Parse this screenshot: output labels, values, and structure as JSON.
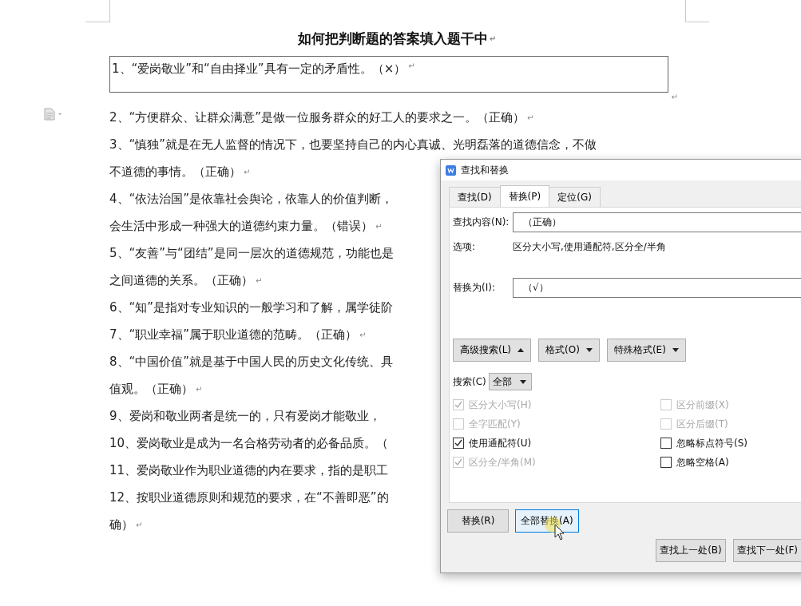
{
  "document": {
    "title": "如何把判断题的答案填入题干中",
    "title_end": "↵",
    "text_box": {
      "text": "1、“爱岗敬业”和“自由择业”具有一定的矛盾性。（×）",
      "end": "↵",
      "after": "↵"
    },
    "lines": [
      {
        "text": "2、“方便群众、让群众满意”是做一位服务群众的好工人的要求之一。（正确）",
        "end": "↵"
      },
      {
        "text": "3、“慎独”就是在无人监督的情况下，也要坚持自己的内心真诚、光明磊落的道德信念，不做"
      },
      {
        "text": "不道德的事情。（正确）",
        "end": "↵"
      },
      {
        "text": "4、“依法治国”是依靠社会舆论，依靠人的价值判断，"
      },
      {
        "text": "会生活中形成一种强大的道德约束力量。（错误）",
        "end": "↵"
      },
      {
        "text": "5、“友善”与“团结”是同一层次的道德规范，功能也是"
      },
      {
        "text": "之间道德的关系。（正确）",
        "end": "↵"
      },
      {
        "text": "6、“知”是指对专业知识的一般学习和了解，属学徒阶"
      },
      {
        "text": "7、“职业幸福”属于职业道德的范畴。（正确）",
        "end": "↵"
      },
      {
        "text": "8、“中国价值”就是基于中国人民的历史文化传统、具"
      },
      {
        "text": "值观。（正确）",
        "end": "↵"
      },
      {
        "text": "9、爱岗和敬业两者是统一的，只有爱岗才能敬业，"
      },
      {
        "text": "10、爱岗敬业是成为一名合格劳动者的必备品质。（"
      },
      {
        "text": "11、爱岗敬业作为职业道德的内在要求，指的是职工"
      },
      {
        "text": "12、按职业道德原则和规范的要求，在“不善即恶”的"
      },
      {
        "text": "确）",
        "end": "↵"
      }
    ]
  },
  "dialog": {
    "title": "查找和替换",
    "tabs": [
      {
        "label": "查找(D)",
        "selected": false
      },
      {
        "label": "替换(P)",
        "selected": true
      },
      {
        "label": "定位(G)",
        "selected": false
      }
    ],
    "find": {
      "label": "查找内容(N):",
      "value": "（正确）"
    },
    "options": {
      "label": "选项:",
      "value": "区分大小写,使用通配符,区分全/半角"
    },
    "replace": {
      "label": "替换为(I):",
      "value": "（√）"
    },
    "tool_buttons": [
      {
        "label": "高级搜索(L)",
        "kind": "collapse"
      },
      {
        "label": "格式(O)",
        "kind": "dropdown"
      },
      {
        "label": "特殊格式(E)",
        "kind": "dropdown"
      }
    ],
    "search_scope": {
      "label": "搜索(C)",
      "value": "全部"
    },
    "checkboxes_left": [
      {
        "label": "区分大小写(H)",
        "checked": true,
        "disabled": true
      },
      {
        "label": "全字匹配(Y)",
        "checked": false,
        "disabled": true
      },
      {
        "label": "使用通配符(U)",
        "checked": true,
        "disabled": false
      },
      {
        "label": "区分全/半角(M)",
        "checked": true,
        "disabled": true
      }
    ],
    "checkboxes_right": [
      {
        "label": "区分前缀(X)",
        "checked": false,
        "disabled": true
      },
      {
        "label": "区分后缀(T)",
        "checked": false,
        "disabled": true
      },
      {
        "label": "忽略标点符号(S)",
        "checked": false,
        "disabled": false
      },
      {
        "label": "忽略空格(A)",
        "checked": false,
        "disabled": false
      }
    ],
    "action_buttons": [
      {
        "label": "替换(R)",
        "focused": false
      },
      {
        "label": "全部替换(A)",
        "focused": true
      }
    ],
    "nav_buttons": [
      "查找上一处(B)",
      "查找下一处(F)"
    ]
  }
}
